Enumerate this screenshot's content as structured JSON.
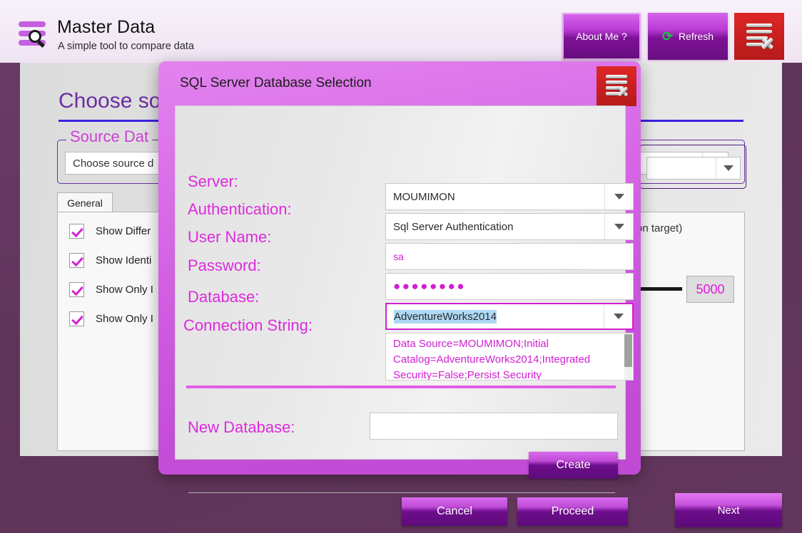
{
  "app": {
    "title": "Master Data",
    "subtitle": "A simple tool to compare data",
    "logo_icon": "data-list-search-icon"
  },
  "header": {
    "about_label": "About Me ?",
    "refresh_label": "Refresh",
    "refresh_icon": "circular-refresh-icon",
    "close_icon": "list-delete-icon"
  },
  "background": {
    "page_heading": "Choose so",
    "source_group_label": "Source Dat",
    "source_combo_value": "Choose source d",
    "tab_label": "General",
    "checkboxes": [
      {
        "label": "Show Differ",
        "checked": true
      },
      {
        "label": "Show Identi",
        "checked": true
      },
      {
        "label": "Show Only I",
        "checked": true
      },
      {
        "label": "Show Only I",
        "checked": true
      }
    ],
    "target_combo_value": "",
    "target_note": "on target)",
    "spin_value": "5000",
    "next_label": "Next"
  },
  "modal": {
    "title": "SQL Server Database Selection",
    "close_icon": "list-delete-icon",
    "labels": {
      "server": "Server:",
      "authentication": "Authentication:",
      "user_name": "User Name:",
      "password": "Password:",
      "database": "Database:",
      "connection_string": "Connection String:",
      "new_database": "New Database:"
    },
    "values": {
      "server": "MOUMIMON",
      "authentication": "Sql Server Authentication",
      "user_name": "sa",
      "password_mask": "●●●●●●●●",
      "database": "AdventureWorks2014",
      "connection_string": "Data Source=MOUMIMON;Initial Catalog=AdventureWorks2014;Integrated Security=False;Persist Security",
      "new_database": ""
    },
    "buttons": {
      "create": "Create",
      "cancel": "Cancel",
      "proceed": "Proceed"
    }
  },
  "colors": {
    "magenta": "#dd2bdd",
    "purple": "#6a2ea0",
    "accent_pink": "#e15ee8",
    "close_red": "#c91f1f",
    "selection_blue": "#add9f4"
  }
}
